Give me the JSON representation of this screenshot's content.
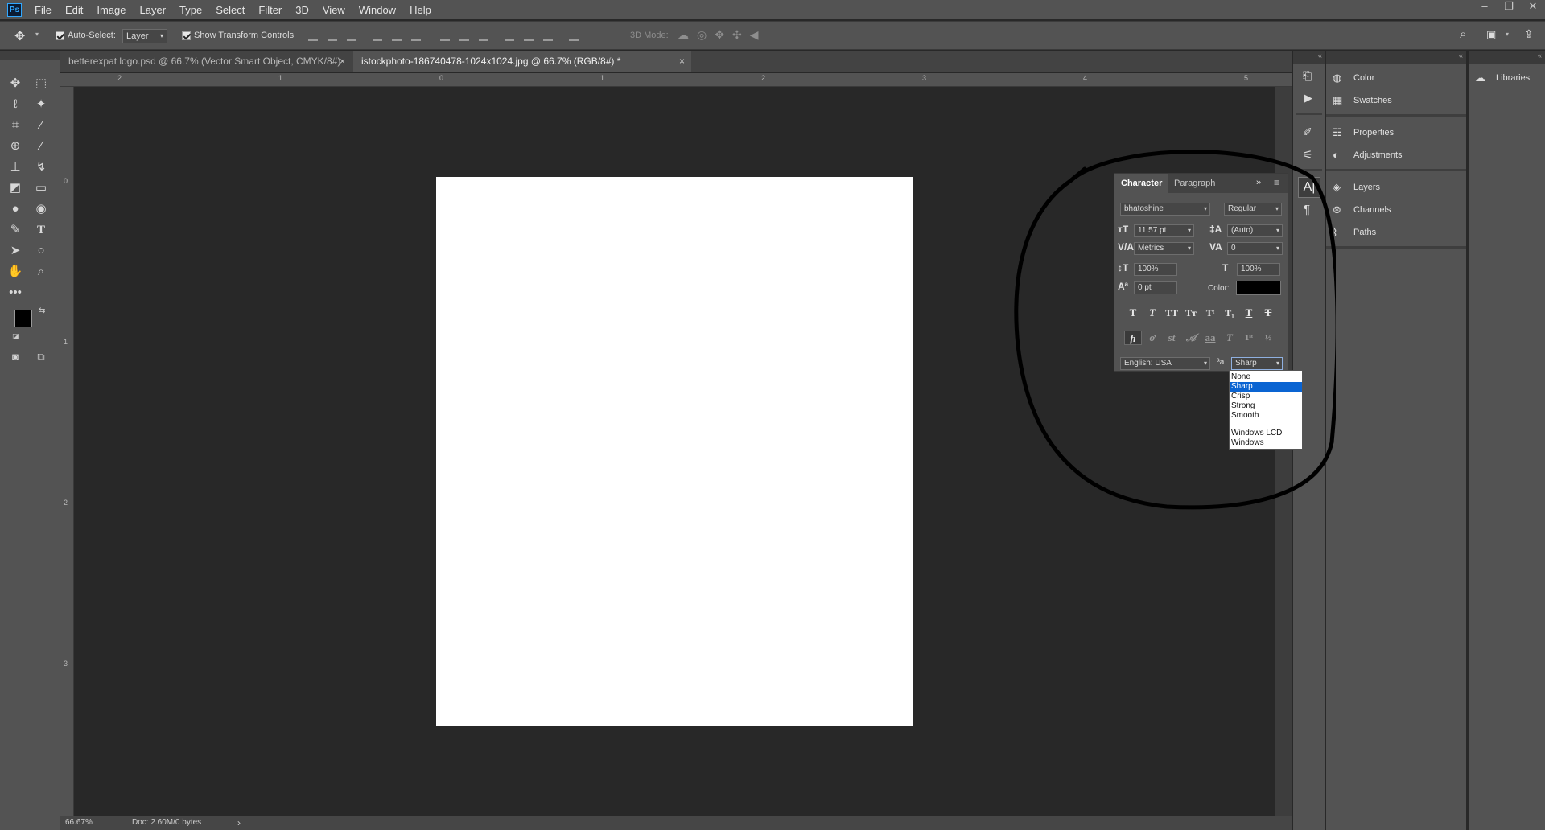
{
  "app": {
    "logo": "Ps"
  },
  "menu": [
    "File",
    "Edit",
    "Image",
    "Layer",
    "Type",
    "Select",
    "Filter",
    "3D",
    "View",
    "Window",
    "Help"
  ],
  "window_controls": {
    "minimize": "–",
    "restore": "❐",
    "close": "✕"
  },
  "options": {
    "auto_select_label": "Auto-Select:",
    "auto_select_value": "Layer",
    "transform_label": "Show Transform Controls",
    "mode3d_label": "3D Mode:"
  },
  "tabs": [
    {
      "label": "betterexpat logo.psd @ 66.7% (Vector Smart Object, CMYK/8#)",
      "active": false
    },
    {
      "label": "istockphoto-186740478-1024x1024.jpg @ 66.7% (RGB/8#) *",
      "active": true
    }
  ],
  "ruler": {
    "top": [
      "2",
      "1",
      "0",
      "1",
      "2",
      "3",
      "4",
      "5"
    ],
    "left": [
      "0",
      "1",
      "2",
      "3"
    ]
  },
  "status": {
    "zoom": "66.67%",
    "doc": "Doc: 2.60M/0 bytes",
    "arrow": "›"
  },
  "panels": {
    "group1": [
      "Color",
      "Swatches"
    ],
    "group2": [
      "Properties",
      "Adjustments"
    ],
    "group3": [
      "Layers",
      "Channels",
      "Paths"
    ],
    "libraries": "Libraries"
  },
  "character": {
    "tabs": [
      "Character",
      "Paragraph"
    ],
    "font_family": "bhatoshine",
    "font_style": "Regular",
    "size": "11.57 pt",
    "leading": "(Auto)",
    "kerning": "Metrics",
    "tracking": "0",
    "vscale": "100%",
    "hscale": "100%",
    "baseline": "0 pt",
    "color_label": "Color:",
    "color": "#000000",
    "language": "English: USA",
    "antialias": "Sharp",
    "aa_icon": "ªa"
  },
  "antialias_menu": {
    "items": [
      "None",
      "Sharp",
      "Crisp",
      "Strong",
      "Smooth"
    ],
    "items2": [
      "Windows LCD",
      "Windows"
    ],
    "selected": "Sharp"
  },
  "colors": {
    "foreground": "#000000",
    "background": "#ffffff",
    "annotation": "#000000",
    "highlight": "#0a64d2"
  }
}
